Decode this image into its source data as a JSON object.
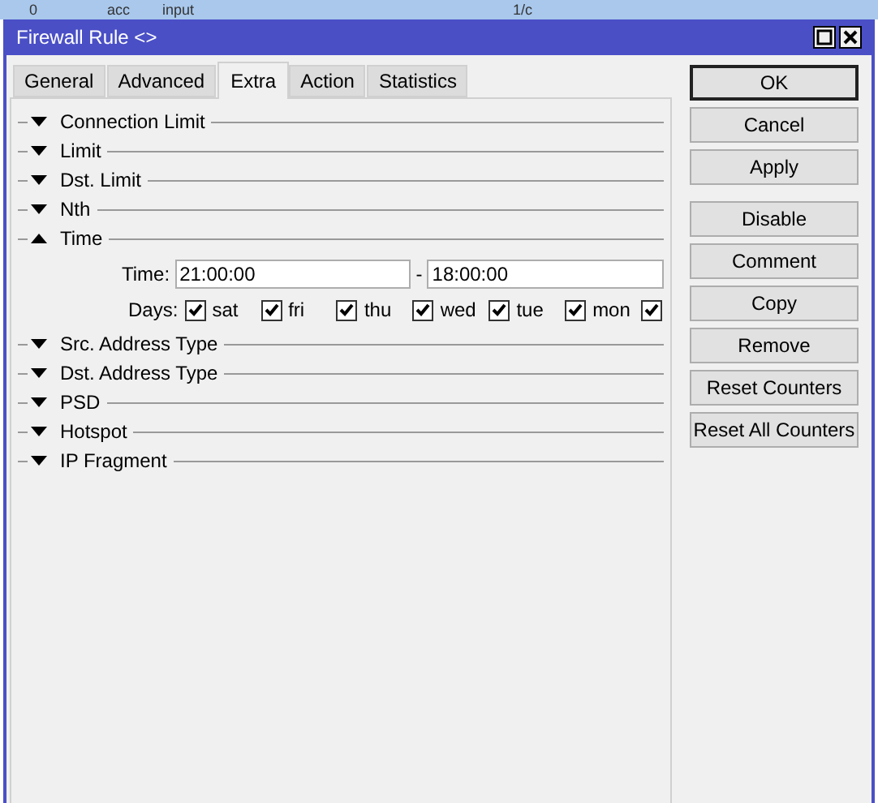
{
  "background_row": [
    "0",
    "acc",
    "input",
    "1/c"
  ],
  "window": {
    "title": "Firewall Rule <>"
  },
  "tabs": [
    {
      "label": "General",
      "selected": false
    },
    {
      "label": "Advanced",
      "selected": false
    },
    {
      "label": "Extra",
      "selected": true
    },
    {
      "label": "Action",
      "selected": false
    },
    {
      "label": "Statistics",
      "selected": false
    }
  ],
  "sections": [
    {
      "label": "Connection Limit",
      "expanded": false
    },
    {
      "label": "Limit",
      "expanded": false
    },
    {
      "label": "Dst. Limit",
      "expanded": false
    },
    {
      "label": "Nth",
      "expanded": false
    },
    {
      "label": "Time",
      "expanded": true,
      "time_label": "Time:",
      "time_from": "21:00:00",
      "separator": "-",
      "time_to": "18:00:00",
      "days_label": "Days:",
      "days": [
        {
          "label": "sat",
          "checked": true
        },
        {
          "label": "fri",
          "checked": true
        },
        {
          "label": "thu",
          "checked": true
        },
        {
          "label": "wed",
          "checked": true
        },
        {
          "label": "tue",
          "checked": true
        },
        {
          "label": "mon",
          "checked": true
        },
        {
          "checked": true
        }
      ]
    },
    {
      "label": "Src. Address Type",
      "expanded": false
    },
    {
      "label": "Dst. Address Type",
      "expanded": false
    },
    {
      "label": "PSD",
      "expanded": false
    },
    {
      "label": "Hotspot",
      "expanded": false
    },
    {
      "label": "IP Fragment",
      "expanded": false
    }
  ],
  "buttons": [
    {
      "label": "OK",
      "default": true
    },
    {
      "label": "Cancel",
      "default": false
    },
    {
      "label": "Apply",
      "default": false
    },
    {
      "label": "Disable",
      "default": false
    },
    {
      "label": "Comment",
      "default": false
    },
    {
      "label": "Copy",
      "default": false
    },
    {
      "label": "Remove",
      "default": false
    },
    {
      "label": "Reset Counters",
      "default": false
    },
    {
      "label": "Reset All Counters",
      "default": false
    }
  ]
}
